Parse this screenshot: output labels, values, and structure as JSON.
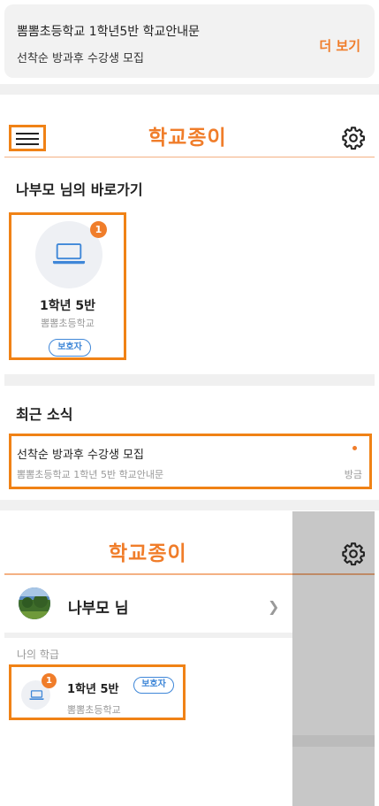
{
  "notification": {
    "title": "뽐뽐초등학교 1학년5반 학교안내문",
    "body": "선착순 방과후 수강생 모집",
    "more_label": "더 보기"
  },
  "app": {
    "name": "학교종이",
    "accent_color": "#f07d2a",
    "highlight_color": "#f08216"
  },
  "shortcuts": {
    "title": "나부모 님의 바로가기",
    "items": [
      {
        "icon": "laptop-icon",
        "badge": "1",
        "class_name": "1학년 5반",
        "school": "뽐뽐초등학교",
        "role": "보호자"
      }
    ]
  },
  "recent_news": {
    "title": "최근 소식",
    "items": [
      {
        "title": "선착순 방과후 수강생 모집",
        "subtitle": "뽐뽐초등학교 1학년 5반 학교안내문",
        "time": "방금"
      }
    ]
  },
  "menu": {
    "app_name": "학교종이",
    "profile_name": "나부모 님",
    "section_label": "나의 학급",
    "classes": [
      {
        "badge": "1",
        "class_name": "1학년 5반",
        "role": "보호자",
        "school": "뽐뽐초등학교"
      }
    ]
  }
}
